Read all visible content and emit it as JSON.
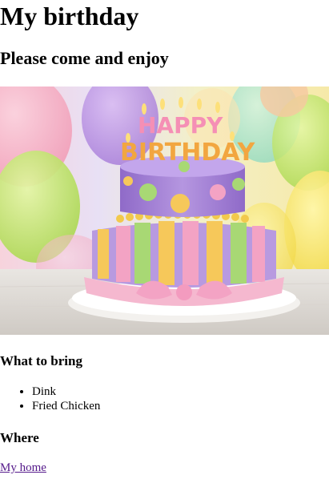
{
  "page": {
    "title": "My birthday",
    "subtitle": "Please come and enjoy"
  },
  "image": {
    "subject": "birthday-cake-photo",
    "cake_topper_text": "HAPPY BIRTHDAY"
  },
  "bring": {
    "heading": "What to bring",
    "items": [
      "Dink",
      "Fried Chicken"
    ]
  },
  "where": {
    "heading": "Where",
    "link_label": "My home"
  },
  "colors": {
    "link_visited": "#551a8b",
    "text": "#000000",
    "background": "#ffffff"
  }
}
